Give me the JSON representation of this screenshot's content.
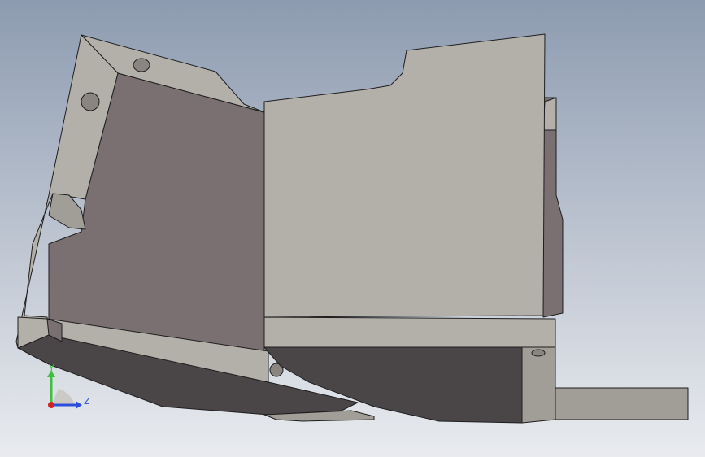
{
  "viewport": {
    "background_top": "#8d9bb0",
    "background_bottom": "#e9ebef"
  },
  "model": {
    "colors": {
      "face_light": "#b3b0aa",
      "face_mid": "#a19e98",
      "face_dark": "#7a7072",
      "face_shadow": "#4a4647",
      "edge": "#1e1e1e",
      "hole_fill": "#8a8580"
    }
  },
  "triad": {
    "y_axis_label": "Y",
    "z_axis_label": "Z",
    "y_color": "#3fbf3f",
    "z_color": "#2b4fd8",
    "origin_color": "#d62020"
  }
}
